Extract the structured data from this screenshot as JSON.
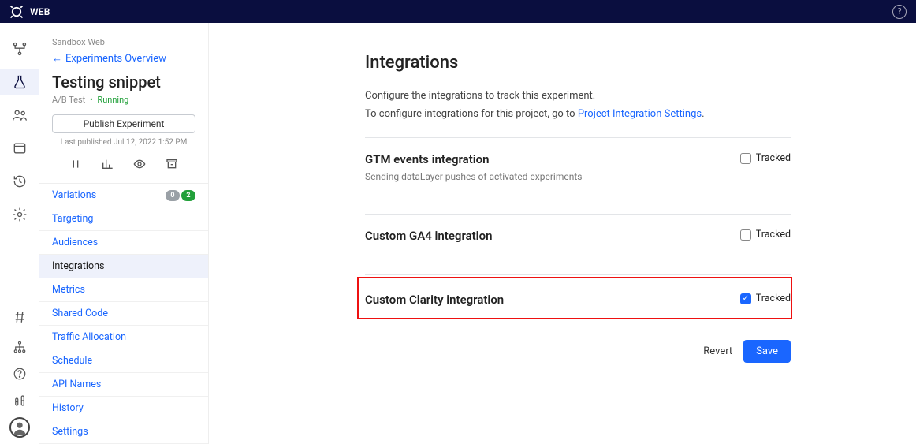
{
  "topbar": {
    "product": "WEB"
  },
  "sidebar": {
    "project": "Sandbox Web",
    "back_label": "Experiments Overview",
    "exp_title": "Testing snippet",
    "exp_type": "A/B Test",
    "exp_status": "Running",
    "publish_label": "Publish Experiment",
    "last_published": "Last published Jul 12, 2022 1:52 PM",
    "variations_badges": {
      "gray": "0",
      "green": "2"
    },
    "nav": [
      "Variations",
      "Targeting",
      "Audiences",
      "Integrations",
      "Metrics",
      "Shared Code",
      "Traffic Allocation",
      "Schedule",
      "API Names",
      "History",
      "Settings"
    ],
    "active_nav_index": 3
  },
  "page": {
    "title": "Integrations",
    "desc1": "Configure the integrations to track this experiment.",
    "desc2_pre": "To configure integrations for this project, go to ",
    "desc2_link": "Project Integration Settings",
    "tracked_label": "Tracked",
    "integrations": [
      {
        "title": "GTM events integration",
        "desc": "Sending dataLayer pushes of activated experiments",
        "checked": false,
        "highlighted": false
      },
      {
        "title": "Custom GA4 integration",
        "desc": "",
        "checked": false,
        "highlighted": false
      },
      {
        "title": "Custom Clarity integration",
        "desc": "",
        "checked": true,
        "highlighted": true
      }
    ],
    "revert": "Revert",
    "save": "Save"
  }
}
